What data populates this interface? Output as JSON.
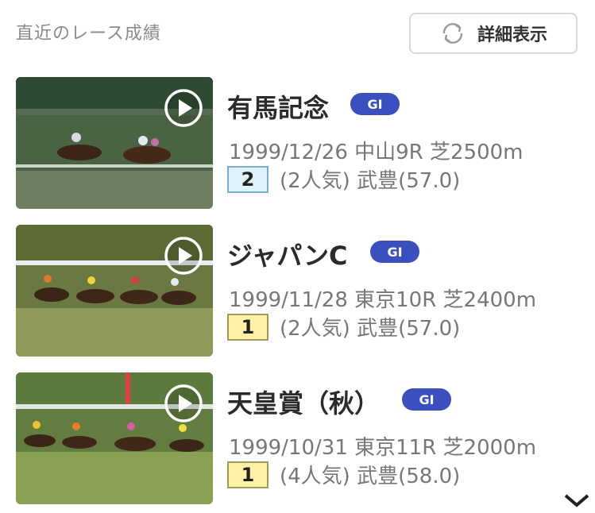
{
  "header": {
    "title": "直近のレース成績",
    "detail_button_label": "詳細表示"
  },
  "races": [
    {
      "name": "有馬記念",
      "grade": "GI",
      "date": "1999/12/26",
      "course": "中山9R",
      "surface_distance": "芝2500m",
      "finish": "2",
      "popularity": "(2人気)",
      "jockey_weight": "武豊(57.0)",
      "finish_color": "#dff1fb"
    },
    {
      "name": "ジャパンC",
      "grade": "GI",
      "date": "1999/11/28",
      "course": "東京10R",
      "surface_distance": "芝2400m",
      "finish": "1",
      "popularity": "(2人気)",
      "jockey_weight": "武豊(57.0)",
      "finish_color": "#fff2a6"
    },
    {
      "name": "天皇賞（秋）",
      "grade": "GI",
      "date": "1999/10/31",
      "course": "東京11R",
      "surface_distance": "芝2000m",
      "finish": "1",
      "popularity": "(4人気)",
      "jockey_weight": "武豊(58.0)",
      "finish_color": "#fff2a6"
    }
  ],
  "icons": {
    "refresh": "refresh-icon",
    "play": "play-icon",
    "more": "chevron-down-icon"
  },
  "colors": {
    "grade_badge": "#3c4fbf"
  }
}
